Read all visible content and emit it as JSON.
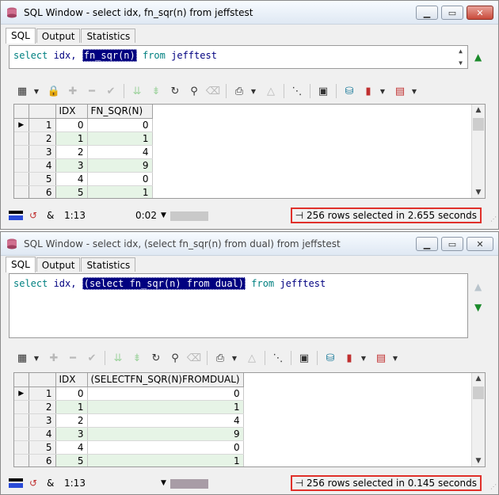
{
  "windows": [
    {
      "title": "SQL Window - select idx, fn_sqr(n) from jeffstest",
      "tabs": [
        "SQL",
        "Output",
        "Statistics"
      ],
      "sql": {
        "kw_select": "select",
        "plain": " idx, ",
        "selected": "fn_sqr(n)",
        "kw_from": "from",
        "table": " jefftest"
      },
      "columns": [
        "IDX",
        "FN_SQR(N)"
      ],
      "rows": [
        {
          "rn": "1",
          "idx": "0",
          "val": "0"
        },
        {
          "rn": "2",
          "idx": "1",
          "val": "1"
        },
        {
          "rn": "3",
          "idx": "2",
          "val": "4"
        },
        {
          "rn": "4",
          "idx": "3",
          "val": "9"
        },
        {
          "rn": "5",
          "idx": "4",
          "val": "0"
        },
        {
          "rn": "6",
          "idx": "5",
          "val": "1"
        }
      ],
      "status": {
        "amp": "&",
        "position": "1:13",
        "time": "0:02",
        "message": "256 rows selected in 2.655 seconds"
      }
    },
    {
      "title": "SQL Window - select idx, (select fn_sqr(n) from dual) from jeffstest",
      "tabs": [
        "SQL",
        "Output",
        "Statistics"
      ],
      "sql": {
        "kw_select": "select",
        "plain": " idx, ",
        "selected": "(select fn_sqr(n) from dual)",
        "kw_from": "from",
        "table": " jefftest"
      },
      "columns": [
        "IDX",
        "(SELECTFN_SQR(N)FROMDUAL)"
      ],
      "rows": [
        {
          "rn": "1",
          "idx": "0",
          "val": "0"
        },
        {
          "rn": "2",
          "idx": "1",
          "val": "1"
        },
        {
          "rn": "3",
          "idx": "2",
          "val": "4"
        },
        {
          "rn": "4",
          "idx": "3",
          "val": "9"
        },
        {
          "rn": "5",
          "idx": "4",
          "val": "0"
        },
        {
          "rn": "6",
          "idx": "5",
          "val": "1"
        }
      ],
      "status": {
        "amp": "&",
        "position": "1:13",
        "time": "",
        "message": "256 rows selected in 0.145 seconds"
      }
    }
  ],
  "colors": {
    "highlight_box": "#e0302a",
    "selection": "#000080",
    "keyword": "#008080",
    "alt_row": "#e6f4e6"
  },
  "icons": [
    "grid-icon",
    "lock-icon",
    "add-icon",
    "remove-icon",
    "check-icon",
    "fetch-next-icon",
    "fetch-last-icon",
    "refresh-icon",
    "find-icon",
    "clear-icon",
    "print-icon",
    "up-icon",
    "tree-icon",
    "save-icon",
    "export-icon",
    "chart-icon",
    "table-icon"
  ]
}
